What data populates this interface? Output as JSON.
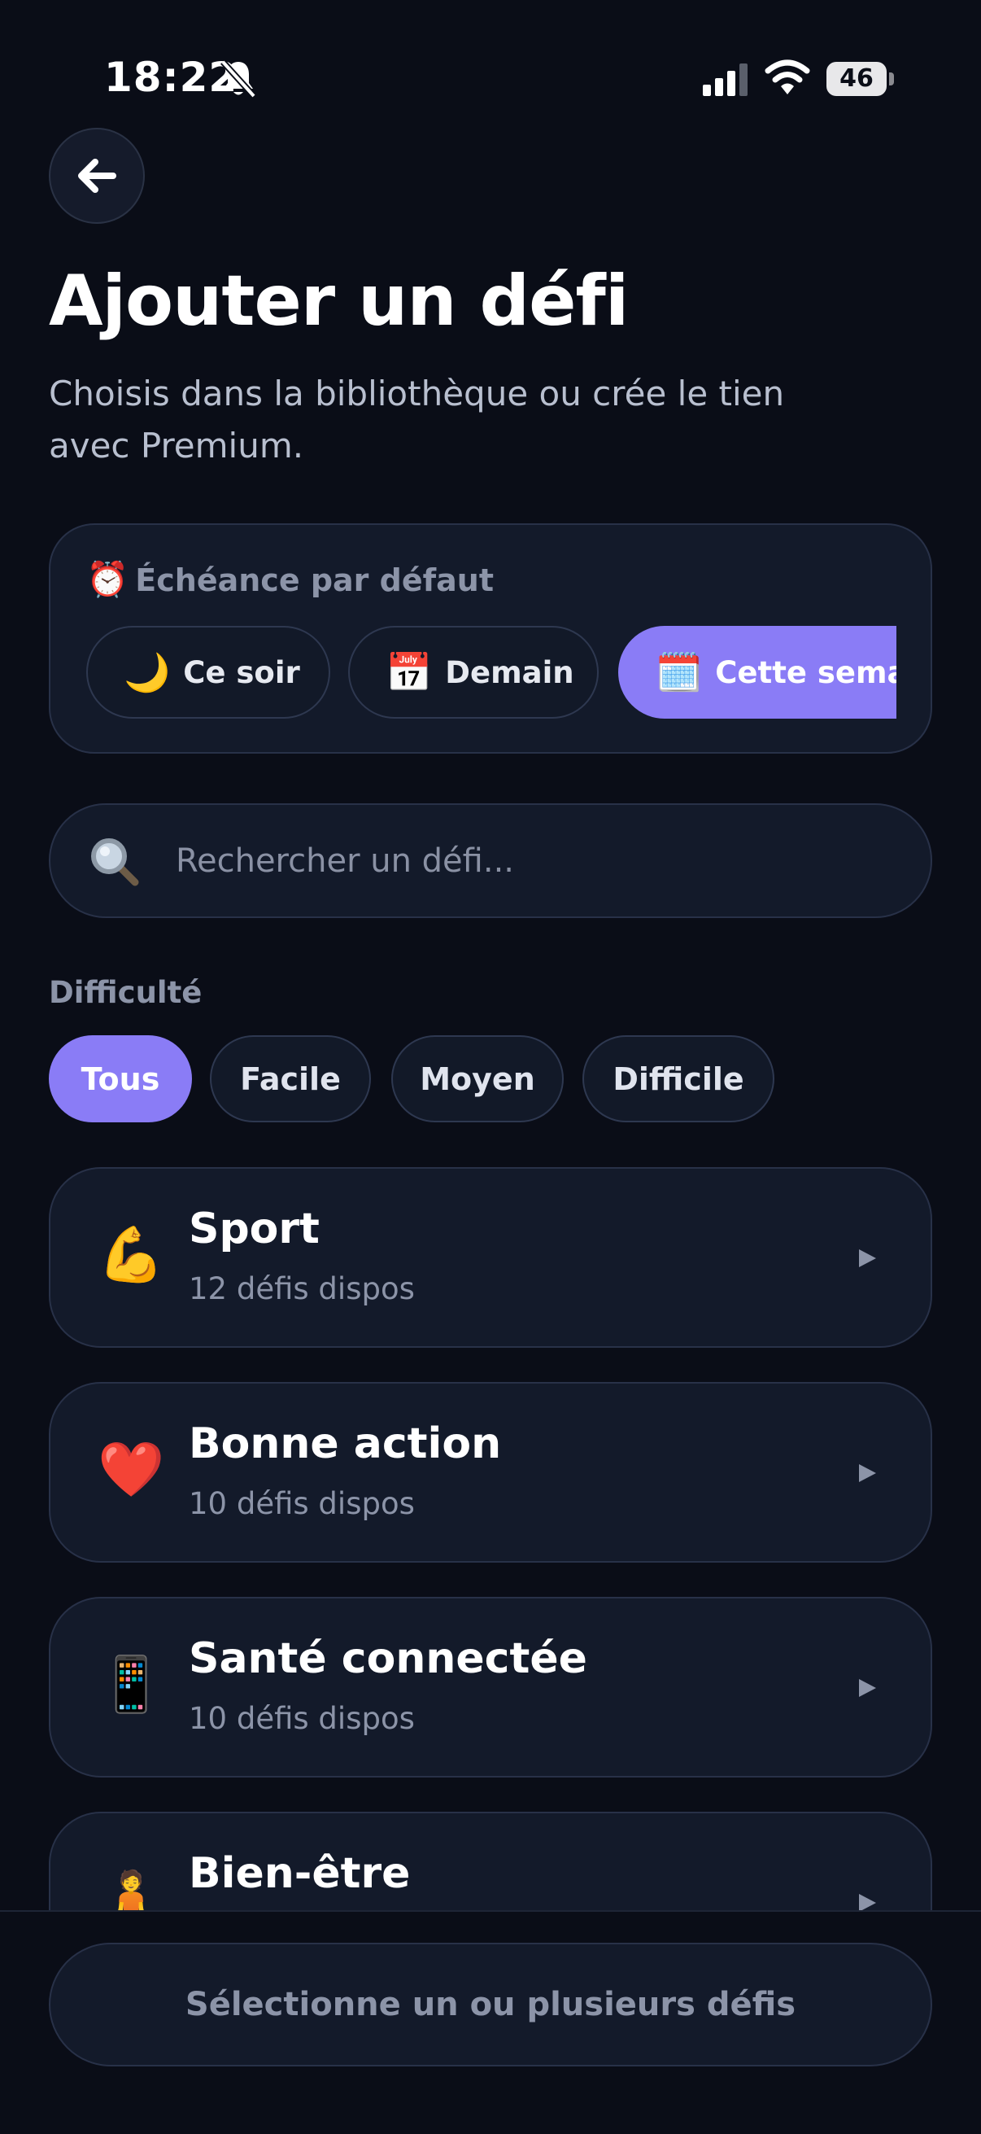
{
  "status_bar": {
    "time": "18:22",
    "battery": "46",
    "icons": [
      "bell-muted-icon",
      "cellular-signal-icon",
      "wifi-icon",
      "battery-icon"
    ]
  },
  "header": {
    "back_icon": "arrow-left-icon",
    "title": "Ajouter un défi",
    "subtitle": "Choisis dans la bibliothèque ou crée le tien avec Premium."
  },
  "deadline": {
    "label_emoji": "⏰",
    "label": "Échéance par défaut",
    "options": [
      {
        "emoji": "🌙",
        "label": "Ce soir",
        "selected": false
      },
      {
        "emoji": "📅",
        "label": "Demain",
        "selected": false
      },
      {
        "emoji": "🗓️",
        "label": "Cette semaine",
        "selected": true
      }
    ]
  },
  "search": {
    "icon": "magnifying-glass-icon",
    "placeholder": "Rechercher un défi...",
    "value": ""
  },
  "difficulty": {
    "label": "Difficulté",
    "options": [
      {
        "label": "Tous",
        "selected": true
      },
      {
        "label": "Facile",
        "selected": false
      },
      {
        "label": "Moyen",
        "selected": false
      },
      {
        "label": "Difficile",
        "selected": false
      }
    ]
  },
  "categories": [
    {
      "emoji": "💪",
      "title": "Sport",
      "count": "12 défis dispos"
    },
    {
      "emoji": "❤️",
      "title": "Bonne action",
      "count": "10 défis dispos"
    },
    {
      "emoji": "📱",
      "title": "Santé connectée",
      "count": "10 défis dispos"
    },
    {
      "emoji": "🧘",
      "title": "Bien-être",
      "count": ""
    }
  ],
  "footer": {
    "button_label": "Sélectionne un ou plusieurs défis"
  },
  "colors": {
    "background": "#0a0d17",
    "card": "#131a2a",
    "accent": "#8a7cf6",
    "muted_text": "#8c94a8"
  }
}
